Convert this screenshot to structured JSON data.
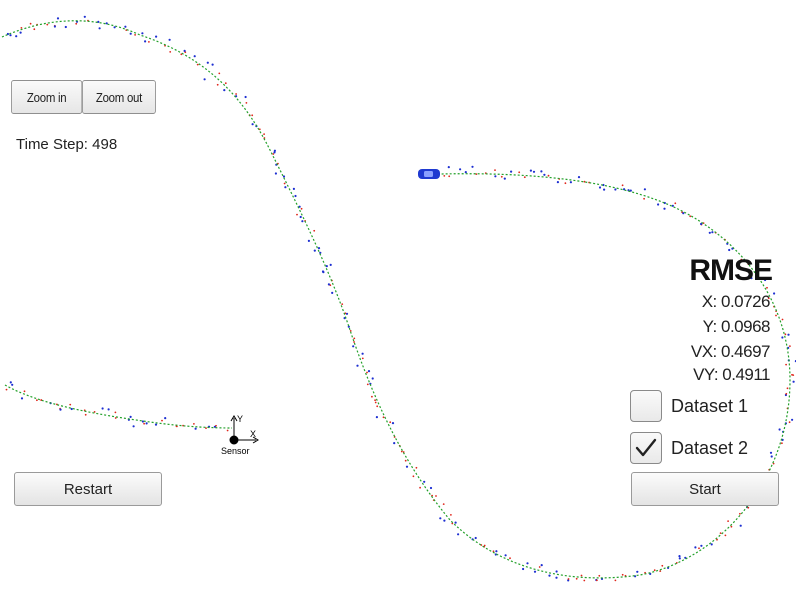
{
  "toolbar": {
    "zoom_in_label": "Zoom in",
    "zoom_out_label": "Zoom out"
  },
  "status": {
    "time_step_text": "Time Step: 498"
  },
  "controls": {
    "restart_label": "Restart",
    "start_label": "Start"
  },
  "rmse": {
    "title": "RMSE",
    "x": "X: 0.0726",
    "y": "Y: 0.0968",
    "vx": "VX: 0.4697",
    "vy": "VY: 0.4911"
  },
  "datasets": [
    {
      "label": "Dataset 1",
      "checked": false
    },
    {
      "label": "Dataset 2",
      "checked": true
    }
  ],
  "sensor": {
    "label": "Sensor",
    "x_axis": "X",
    "y_axis": "Y"
  },
  "colors": {
    "estimate": "#23a02a",
    "lidar": "#e0261b",
    "radar": "#1d2fd1",
    "car": "#1f3ad1"
  },
  "icons": {
    "check": "check-icon",
    "car": "car-icon",
    "sensor": "sensor-origin-icon"
  }
}
